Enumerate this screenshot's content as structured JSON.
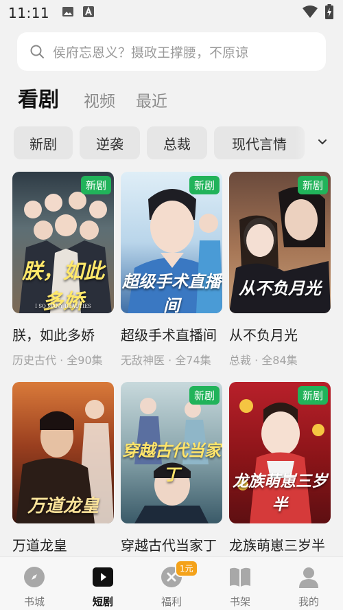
{
  "status_bar": {
    "time": "11:11"
  },
  "search": {
    "placeholder": "侯府忘恩义？摄政王撑腰，不原谅"
  },
  "top_tabs": [
    {
      "label": "看剧",
      "active": true
    },
    {
      "label": "视频",
      "active": false
    },
    {
      "label": "最近",
      "active": false
    }
  ],
  "categories": [
    "新剧",
    "逆袭",
    "总裁",
    "现代言情"
  ],
  "dramas": [
    {
      "title": "朕，如此多娇",
      "meta": "历史古代 · 全90集",
      "badge": "新剧",
      "cover_title": "朕，如此多娇",
      "cover_subtitle": "I SO MANY BEAUTIES"
    },
    {
      "title": "超级手术直播间",
      "meta": "无敌神医 · 全74集",
      "badge": "新剧",
      "cover_title": "超级手术直播间"
    },
    {
      "title": "从不负月光",
      "meta": "总裁 · 全84集",
      "badge": "新剧",
      "cover_title": "从不负月光"
    },
    {
      "title": "万道龙皇",
      "meta": "",
      "badge": "",
      "cover_title": "万道龙皇"
    },
    {
      "title": "穿越古代当家丁",
      "meta": "",
      "badge": "新剧",
      "cover_title": "穿越古代当家丁"
    },
    {
      "title": "龙族萌崽三岁半",
      "meta": "",
      "badge": "新剧",
      "cover_title": "龙族萌崽三岁半"
    }
  ],
  "bottom_nav": [
    {
      "label": "书城",
      "icon": "compass-icon",
      "active": false
    },
    {
      "label": "短剧",
      "icon": "play-icon",
      "active": true
    },
    {
      "label": "福利",
      "icon": "gift-icon",
      "active": false,
      "badge": "1元"
    },
    {
      "label": "书架",
      "icon": "book-icon",
      "active": false
    },
    {
      "label": "我的",
      "icon": "person-icon",
      "active": false
    }
  ],
  "colors": {
    "badge_green": "#21b35a",
    "welfare_badge": "#f4a21a"
  }
}
